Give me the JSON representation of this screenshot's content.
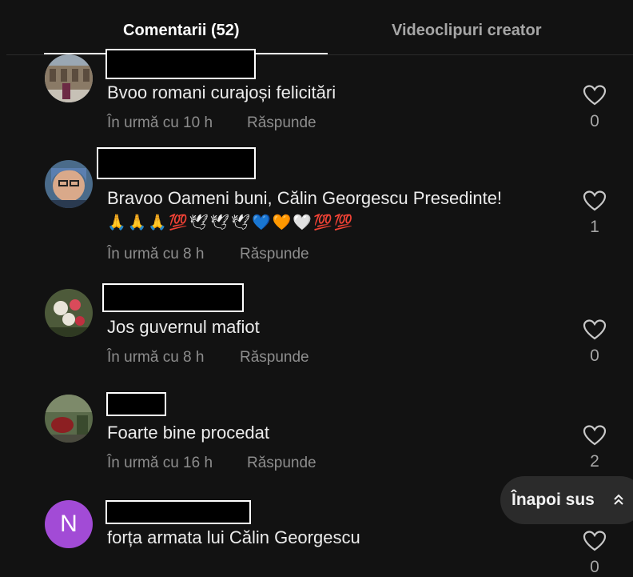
{
  "tabs": [
    {
      "label": "Comentarii (52)",
      "active": true
    },
    {
      "label": "Videoclipuri creator",
      "active": false
    }
  ],
  "comments": [
    {
      "text": "Bvoo romani curajoși felicitări",
      "time": "În urmă cu 10 h",
      "reply": "Răspunde",
      "likes": "0"
    },
    {
      "text": "Bravoo Oameni buni, Călin Georgescu Presedinte!",
      "emoji": "🙏🙏🙏💯🕊🕊🕊💙🧡🤍💯💯",
      "time": "În urmă cu 8 h",
      "reply": "Răspunde",
      "likes": "1"
    },
    {
      "text": "Jos guvernul mafiot",
      "time": "În urmă cu 8 h",
      "reply": "Răspunde",
      "likes": "0"
    },
    {
      "text": "Foarte bine procedat",
      "time": "În urmă cu 16 h",
      "reply": "Răspunde",
      "likes": "2"
    },
    {
      "avatar_letter": "N",
      "text": "forța armata lui Călin Georgescu",
      "likes": "0"
    }
  ],
  "back_to_top": "Înapoi sus",
  "colors": {
    "background": "#121212",
    "avatar_letter_bg": "#a24bd6",
    "redaction": "#000000"
  },
  "icons": [
    "heart-outline-icon",
    "double-chevron-up-icon"
  ]
}
